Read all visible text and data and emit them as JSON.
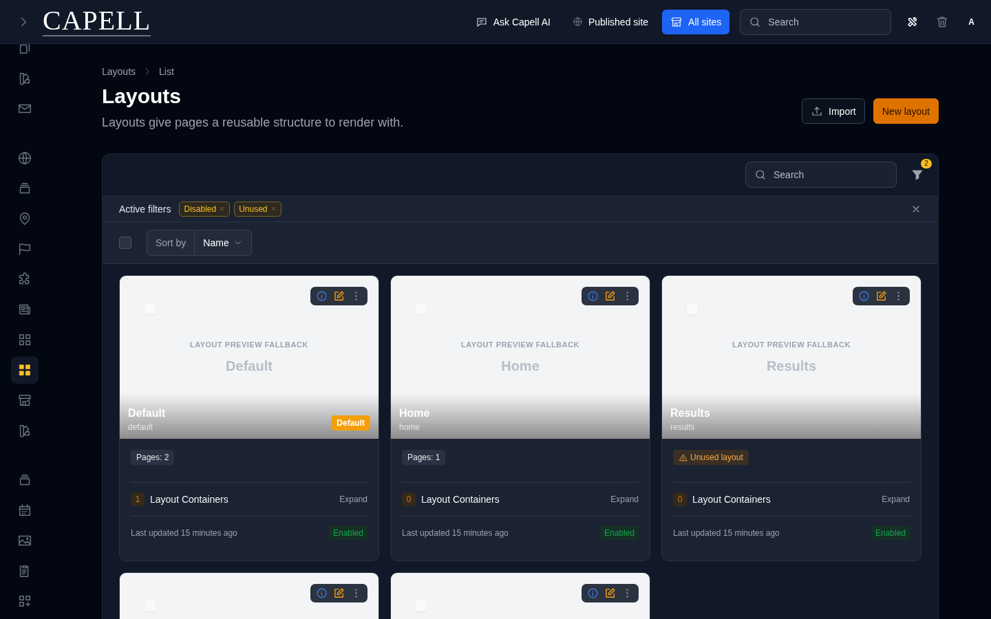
{
  "topbar": {
    "logo": "CAPELL",
    "nav": [
      {
        "kind": "chat",
        "label": "Ask Capell AI",
        "selected": false
      },
      {
        "kind": "globe",
        "label": "Published site",
        "selected": false
      },
      {
        "kind": "store",
        "label": "All sites",
        "selected": true
      }
    ],
    "search": {
      "placeholder": "Search"
    },
    "avatar": "A"
  },
  "sidebar": {
    "items": [
      {
        "kind": "copy",
        "selected": false
      },
      {
        "kind": "swatch",
        "selected": false
      },
      {
        "kind": "mail",
        "selected": false
      },
      {
        "kind": "gap"
      },
      {
        "kind": "globe",
        "selected": false
      },
      {
        "kind": "stack",
        "selected": false
      },
      {
        "kind": "pin",
        "selected": false
      },
      {
        "kind": "flag",
        "selected": false
      },
      {
        "kind": "puzzle",
        "selected": false
      },
      {
        "kind": "news",
        "selected": false
      },
      {
        "kind": "grid",
        "selected": false
      },
      {
        "kind": "grid",
        "selected": true
      },
      {
        "kind": "store",
        "selected": false
      },
      {
        "kind": "swatch",
        "selected": false
      },
      {
        "kind": "gap"
      },
      {
        "kind": "stack",
        "selected": false
      },
      {
        "kind": "calendar",
        "selected": false
      },
      {
        "kind": "image",
        "selected": false
      },
      {
        "kind": "clipboard",
        "selected": false
      },
      {
        "kind": "gridplus",
        "selected": false
      }
    ]
  },
  "breadcrumbs": [
    "Layouts",
    "List"
  ],
  "page": {
    "title": "Layouts",
    "subtitle": "Layouts give pages a reusable structure to render with.",
    "actions": [
      {
        "kind": "import",
        "label": "Import"
      },
      {
        "kind": "primary",
        "label": "New layout"
      }
    ]
  },
  "panel": {
    "search": {
      "placeholder": "Search"
    },
    "filter_count": "2",
    "active_filters": {
      "label": "Active filters",
      "chips": [
        "Disabled",
        "Unused"
      ]
    },
    "select_all": {
      "checked": false
    },
    "sort": {
      "label": "Sort by",
      "value": "Name"
    }
  },
  "cards": [
    {
      "kind": "full",
      "checked": false,
      "preview_label": "LAYOUT PREVIEW FALLBACK",
      "preview_title": "Default",
      "title": "Default",
      "slug": "default",
      "badge": "Default",
      "usage": {
        "kind": "pages",
        "text": "Pages: 2"
      },
      "containers_count": "1",
      "containers_label": "Layout Containers",
      "expand": "Expand",
      "updated": "Last updated 15 minutes ago",
      "status": "Enabled"
    },
    {
      "kind": "full",
      "checked": false,
      "preview_label": "LAYOUT PREVIEW FALLBACK",
      "preview_title": "Home",
      "title": "Home",
      "slug": "home",
      "usage": {
        "kind": "pages",
        "text": "Pages: 1"
      },
      "containers_count": "0",
      "containers_label": "Layout Containers",
      "expand": "Expand",
      "updated": "Last updated 15 minutes ago",
      "status": "Enabled"
    },
    {
      "kind": "full",
      "checked": false,
      "preview_label": "LAYOUT PREVIEW FALLBACK",
      "preview_title": "Results",
      "title": "Results",
      "slug": "results",
      "usage": {
        "kind": "unused",
        "text": "Unused layout"
      },
      "containers_count": "0",
      "containers_label": "Layout Containers",
      "expand": "Expand",
      "updated": "Last updated 15 minutes ago",
      "status": "Enabled"
    },
    {
      "kind": "partial",
      "checked": false
    },
    {
      "kind": "partial",
      "checked": false
    }
  ]
}
